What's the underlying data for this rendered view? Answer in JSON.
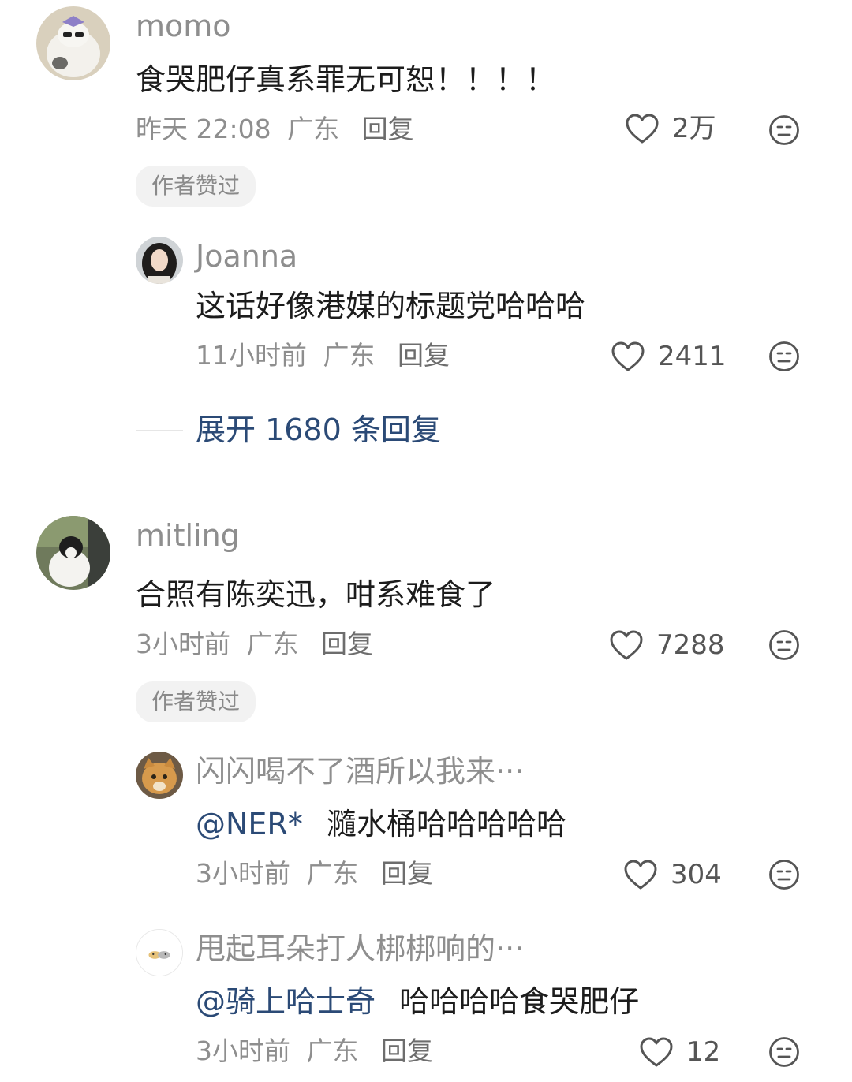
{
  "comments": [
    {
      "username": "momo",
      "text": "食哭肥仔真系罪无可恕！！！！",
      "time": "昨天 22:08",
      "location": "广东",
      "reply_label": "回复",
      "likes": "2万",
      "badge": "作者赞过",
      "replies": [
        {
          "username": "Joanna",
          "text": "这话好像港媒的标题党哈哈哈",
          "time": "11小时前",
          "location": "广东",
          "reply_label": "回复",
          "likes": "2411"
        }
      ],
      "expand_label": "展开 1680 条回复"
    },
    {
      "username": "mitling",
      "text": "合照有陈奕迅，咁系难食了",
      "time": "3小时前",
      "location": "广东",
      "reply_label": "回复",
      "likes": "7288",
      "badge": "作者赞过",
      "replies": [
        {
          "username": "闪闪喝不了酒所以我来···",
          "mention": "@NER*",
          "text": "瀡水桶哈哈哈哈哈",
          "time": "3小时前",
          "location": "广东",
          "reply_label": "回复",
          "likes": "304"
        },
        {
          "username": "甩起耳朵打人梆梆响的···",
          "mention": "@骑上哈士奇",
          "text": "哈哈哈哈食哭肥仔",
          "time": "3小时前",
          "location": "广东",
          "reply_label": "回复",
          "likes": "12"
        }
      ]
    }
  ],
  "icons": {
    "like": "heart-outline-icon",
    "reaction": "neutral-face-icon"
  },
  "colors": {
    "mention": "#2b4a76",
    "meta": "#8e8e8e",
    "badge_bg": "#f2f2f2"
  }
}
